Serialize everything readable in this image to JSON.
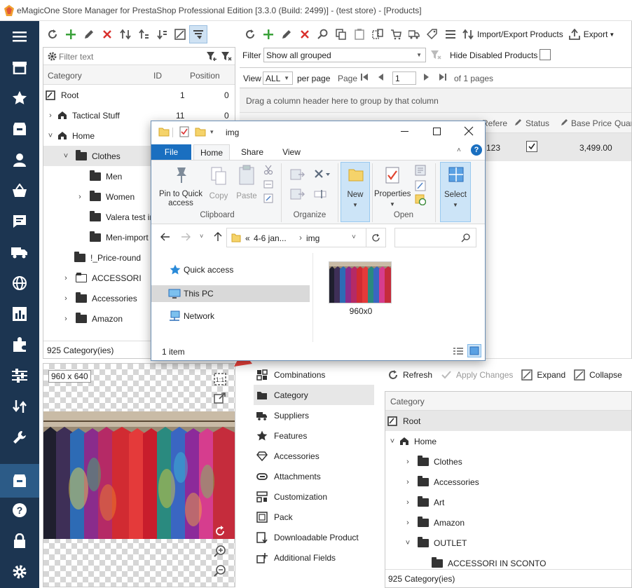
{
  "window": {
    "title": "eMagicOne Store Manager for PrestaShop Professional Edition [3.3.0 (Build: 2499)] - (test store) - [Products]"
  },
  "nav": {
    "icons": [
      "menu-icon",
      "store-icon",
      "star-icon",
      "box-icon",
      "user-icon",
      "basket-icon",
      "comment-icon",
      "truck-icon",
      "globe-icon",
      "chart-icon",
      "puzzle-icon",
      "sliders-icon",
      "arrows-icon",
      "wrench-icon",
      "archive-icon",
      "help-icon",
      "lock-icon",
      "gear-icon"
    ]
  },
  "category_panel": {
    "filter_placeholder": "Filter text",
    "columns": {
      "category": "Category",
      "id": "ID",
      "position": "Position"
    },
    "rows": [
      {
        "label": "Root",
        "id": "1",
        "position": "0"
      },
      {
        "label": "Tactical Stuff",
        "id": "11",
        "position": "0"
      },
      {
        "label": "Home"
      },
      {
        "label": "Clothes"
      },
      {
        "label": "Men"
      },
      {
        "label": "Women"
      },
      {
        "label": "Valera test in"
      },
      {
        "label": "Men-import"
      },
      {
        "label": "!_Price-round"
      },
      {
        "label": "ACCESSORI"
      },
      {
        "label": "Accessories"
      },
      {
        "label": "Amazon"
      }
    ],
    "footer": "925 Category(ies)"
  },
  "product_panel": {
    "toolbar": {
      "import_export": "Import/Export Products",
      "export": "Export"
    },
    "filter_label": "Filter",
    "filter_value": "Show all grouped",
    "hide_disabled": "Hide Disabled Products",
    "view_label": "View",
    "view_value": "ALL",
    "per_page": "per page",
    "page_label": "Page",
    "page_value": "1",
    "of_pages": "of 1 pages",
    "group_hint": "Drag a column header here to group by that column",
    "columns": {
      "reference": "Refere",
      "status": "Status",
      "base_price": "Base Price",
      "quantity": "Quan"
    },
    "row": {
      "reference": "123",
      "base_price": "3,499.00"
    }
  },
  "image_panel": {
    "size_label": "960 x 640"
  },
  "subsections": [
    "Combinations",
    "Category",
    "Suppliers",
    "Features",
    "Accessories",
    "Attachments",
    "Customization",
    "Pack",
    "Downloadable Product",
    "Additional Fields"
  ],
  "assoc_panel": {
    "toolbar": {
      "refresh": "Refresh",
      "apply": "Apply Changes",
      "expand": "Expand",
      "collapse": "Collapse"
    },
    "column": "Category",
    "rows": [
      "Root",
      "Home",
      "Clothes",
      "Accessories",
      "Art",
      "Amazon",
      "OUTLET",
      "ACCESSORI IN SCONTO"
    ],
    "footer": "925 Category(ies)"
  },
  "explorer": {
    "title": "img",
    "tabs": {
      "file": "File",
      "home": "Home",
      "share": "Share",
      "view": "View"
    },
    "ribbon": {
      "pin": "Pin to Quick access",
      "copy": "Copy",
      "paste": "Paste",
      "clipboard": "Clipboard",
      "organize": "Organize",
      "new": "New",
      "properties": "Properties",
      "open": "Open",
      "select": "Select"
    },
    "address": {
      "prefix": "«",
      "folder": "4-6 jan...",
      "current": "img"
    },
    "nav": {
      "quick_access": "Quick access",
      "this_pc": "This PC",
      "network": "Network"
    },
    "file": {
      "name": "960x0"
    },
    "status": "1 item"
  }
}
